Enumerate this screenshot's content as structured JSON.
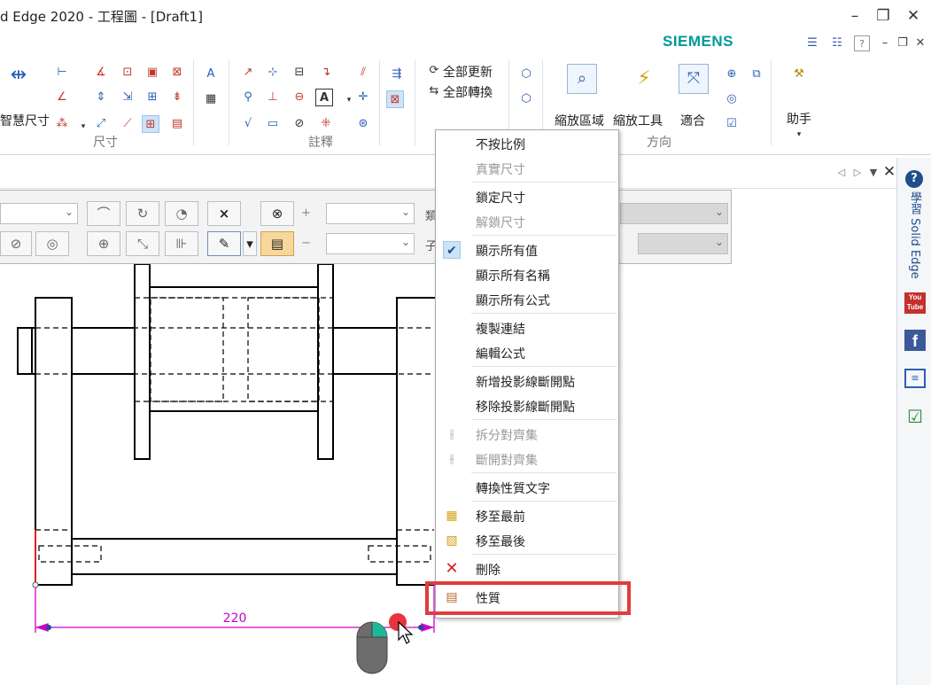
{
  "window": {
    "title": "d Edge 2020 - 工程圖 - [Draft1]",
    "brand": "SIEMENS",
    "brand_color": "#009999",
    "controls": [
      "minimize-icon",
      "restore-icon",
      "close-icon"
    ]
  },
  "ribbon": {
    "smart_dimension_label": "智慧尺寸",
    "dimension_group_label": "尺寸",
    "annotation_group_label": "註釋",
    "update_all_label": "全部更新",
    "convert_all_label": "全部轉換",
    "zoom_area_label": "縮放區域",
    "zoom_tool_label": "縮放工具",
    "fit_label": "適合",
    "orientation_group_label": "方向",
    "assistant_label": "助手"
  },
  "side_panel": {
    "learn_label": "學習 Solid Edge",
    "youtube_label": "You Tube",
    "facebook_label": "f"
  },
  "command_bar": {
    "plus_sign": "+",
    "minus_sign": "−",
    "label_type": "類",
    "label_sub": "子"
  },
  "drawing": {
    "dimension_value": "220",
    "dimension_color": "#cc00cc"
  },
  "context_menu": {
    "items": [
      {
        "label": "不按比例",
        "enabled": true
      },
      {
        "label": "真實尺寸",
        "enabled": false
      },
      {
        "label": "鎖定尺寸",
        "enabled": true
      },
      {
        "label": "解鎖尺寸",
        "enabled": false
      },
      {
        "label": "顯示所有值",
        "enabled": true,
        "checked": true
      },
      {
        "label": "顯示所有名稱",
        "enabled": true
      },
      {
        "label": "顯示所有公式",
        "enabled": true
      },
      {
        "label": "複製連結",
        "enabled": true
      },
      {
        "label": "編輯公式",
        "enabled": true
      },
      {
        "label": "新增投影線斷開點",
        "enabled": true
      },
      {
        "label": "移除投影線斷開點",
        "enabled": true
      },
      {
        "label": "拆分對齊集",
        "enabled": false
      },
      {
        "label": "斷開對齊集",
        "enabled": false
      },
      {
        "label": "轉換性質文字",
        "enabled": true
      },
      {
        "label": "移至最前",
        "enabled": true
      },
      {
        "label": "移至最後",
        "enabled": true
      },
      {
        "label": "刪除",
        "enabled": true
      },
      {
        "label": "性質",
        "enabled": true,
        "highlighted": true
      }
    ],
    "highlight_color": "#e03c3c"
  }
}
